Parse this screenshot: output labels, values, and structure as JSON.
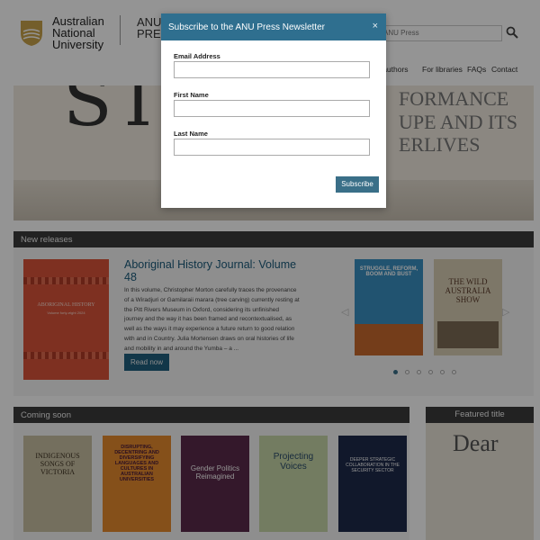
{
  "header": {
    "logo_line1": "Australian",
    "logo_line2": "National",
    "logo_line3": "University",
    "press_line1": "ANU",
    "press_line2": "PRES",
    "search_placeholder": "ANU Press"
  },
  "nav": {
    "items": [
      "r authors",
      "For libraries",
      "FAQs",
      "Contact"
    ]
  },
  "hero": {
    "big_text": "ST",
    "line1": "FORMANCE",
    "line2": "UPE AND ITS",
    "line3": "ERLIVES"
  },
  "new_releases": {
    "heading": "New releases",
    "cover_title": "ABORIGINAL HISTORY",
    "cover_subtitle": "Volume forty-eight 2024",
    "title": "Aboriginal History Journal: Volume 48",
    "description": "In this volume, Christopher Morton carefully traces the provenance of a Wiradjuri or Gamilaraii marara (tree carving) currently resting at the Pitt Rivers Museum in Oxford, considering its unfinished journey and the way it has been framed and recontextualised, as well as the ways it may experience a future return to good relation with and in Country. Julia Mortensen draws on oral histories of life and mobility in and around the Yumba – a ...",
    "read_more": "Read now",
    "carousel": [
      {
        "title": "STRUGGLE, REFORM, BOOM AND BUST"
      },
      {
        "title": "THE WILD AUSTRALIA SHOW"
      }
    ]
  },
  "coming_soon": {
    "heading": "Coming soon",
    "covers": [
      {
        "title": "INDIGENOUS SONGS OF VICTORIA"
      },
      {
        "title": "DISRUPTING, DECENTRING AND DIVERSIFYING LANGUAGES AND CULTURES IN AUSTRALIAN UNIVERSITIES"
      },
      {
        "title": "Gender Politics Reimagined"
      },
      {
        "title": "Projecting Voices"
      },
      {
        "title": "DEEPER STRATEGIC COLLABORATION IN THE SECURITY SECTOR"
      }
    ]
  },
  "featured": {
    "heading": "Featured title",
    "cover_title": "Dear"
  },
  "modal": {
    "title": "Subscribe to the ANU Press Newsletter",
    "close": "×",
    "email_label": "Email Address",
    "first_label": "First Name",
    "last_label": "Last Name",
    "submit": "Subscribe"
  },
  "colors": {
    "modal_header": "#2f6f8f",
    "accent": "#1f5f7f"
  }
}
